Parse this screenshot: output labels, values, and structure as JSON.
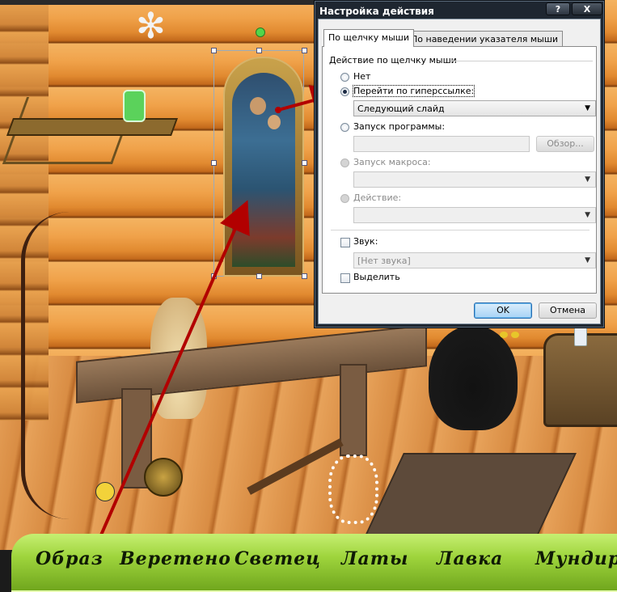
{
  "dialog": {
    "title": "Настройка действия",
    "help_button": "?",
    "close_button": "X",
    "tabs": [
      {
        "label": "По щелчку мыши",
        "active": true
      },
      {
        "label": "По наведении указателя мыши",
        "active": false
      }
    ],
    "group_title": "Действие по щелчку мыши",
    "options": {
      "none": "Нет",
      "hyperlink": "Перейти по гиперссылке:",
      "hyperlink_value": "Следующий слайд",
      "run_program": "Запуск программы:",
      "browse": "Обзор...",
      "run_macro": "Запуск макроса:",
      "action": "Действие:"
    },
    "sound": {
      "label": "Звук:",
      "value": "[Нет звука]"
    },
    "highlight": "Выделить",
    "ok": "OK",
    "cancel": "Отмена"
  },
  "nav": {
    "items": [
      "Образ",
      "Веретено",
      "Светец",
      "Латы",
      "Лавка",
      "Мундир"
    ]
  },
  "colors": {
    "arrow": "#b20000",
    "nav_bar": "#9ed43c",
    "dialog_frame": "#1e2630"
  }
}
